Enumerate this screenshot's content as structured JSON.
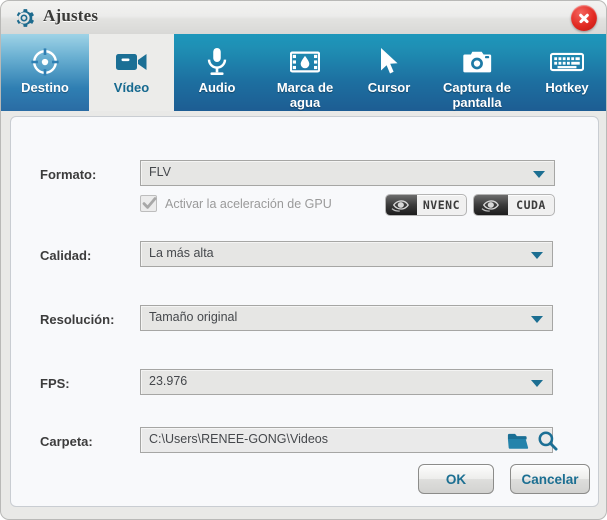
{
  "window": {
    "title": "Ajustes",
    "gear_icon": "gear-icon",
    "close_icon": "close-icon"
  },
  "tabs": [
    {
      "label": "Destino",
      "icon": "target-icon",
      "active": false
    },
    {
      "label": "Vídeo",
      "icon": "camcorder-icon",
      "active": true
    },
    {
      "label": "Audio",
      "icon": "microphone-icon",
      "active": false
    },
    {
      "label": "Marca de\nagua",
      "icon": "watermark-icon",
      "active": false
    },
    {
      "label": "Cursor",
      "icon": "cursor-icon",
      "active": false
    },
    {
      "label": "Captura de\npantalla",
      "icon": "camera-icon",
      "active": false
    },
    {
      "label": "Hotkey",
      "icon": "keyboard-icon",
      "active": false
    }
  ],
  "tab_labels": {
    "destino": "Destino",
    "video": "Vídeo",
    "audio": "Audio",
    "watermark_line1": "Marca de",
    "watermark_line2": "agua",
    "cursor": "Cursor",
    "capture_line1": "Captura de",
    "capture_line2": "pantalla",
    "hotkey": "Hotkey"
  },
  "form": {
    "formato": {
      "label": "Formato:",
      "value": "FLV"
    },
    "calidad": {
      "label": "Calidad:",
      "value": "La más alta"
    },
    "resolucion": {
      "label": "Resolución:",
      "value": "Tamaño original"
    },
    "fps": {
      "label": "FPS:",
      "value": "23.976"
    },
    "carpeta": {
      "label": "Carpeta:",
      "value": "C:\\Users\\RENEE-GONG\\Videos"
    }
  },
  "gpu": {
    "checkbox_label": "Activar la aceleración de GPU",
    "checked": "true",
    "enabled": "false",
    "badges": [
      {
        "text": "NVENC",
        "logo": "nvidia-eye-logo"
      },
      {
        "text": "CUDA",
        "logo": "nvidia-eye-logo"
      }
    ],
    "nvenc_text": "NVENC",
    "cuda_text": "CUDA"
  },
  "carpeta_actions": {
    "browse_icon": "folder-icon",
    "search_icon": "magnifier-icon"
  },
  "buttons": {
    "ok": "OK",
    "cancel": "Cancelar"
  },
  "colors": {
    "tab_bar_top": "#1d97bb",
    "tab_bar_bottom": "#1d5d93",
    "accent_teal": "#1c6f92",
    "active_tab_bg": "#ececea",
    "panel_bg": "#f8f9fb",
    "close_red": "#e22a22",
    "field_bg": "#e6e6e4"
  }
}
